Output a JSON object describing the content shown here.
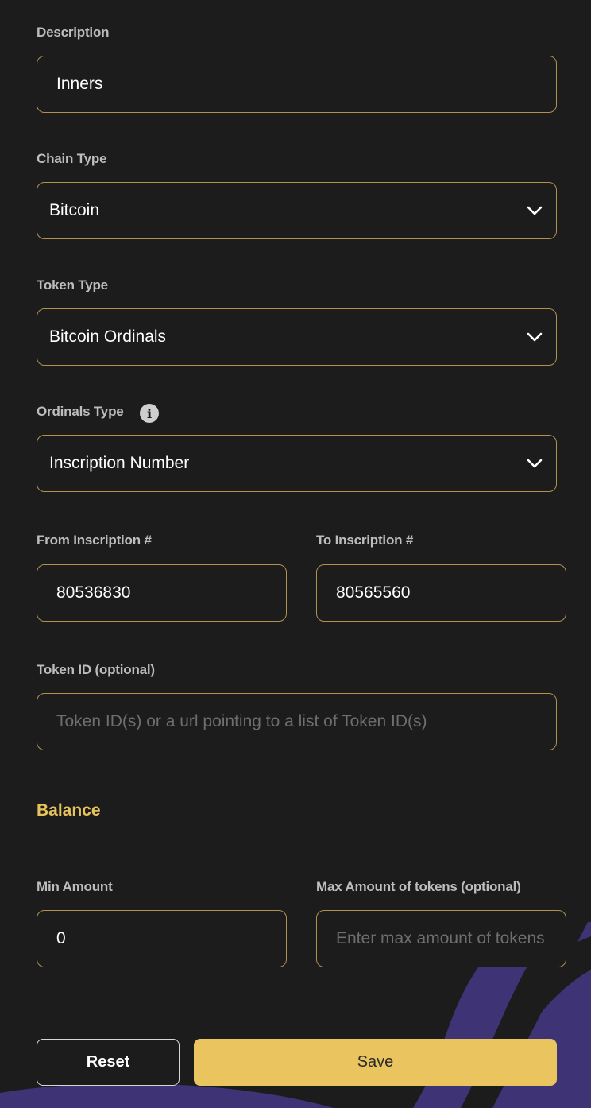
{
  "description": {
    "label": "Description",
    "value": "Inners"
  },
  "chain_type": {
    "label": "Chain Type",
    "value": "Bitcoin"
  },
  "token_type": {
    "label": "Token Type",
    "value": "Bitcoin Ordinals"
  },
  "ordinals_type": {
    "label": "Ordinals Type",
    "value": "Inscription Number",
    "info_icon": "info-icon"
  },
  "from_inscription": {
    "label": "From Inscription #",
    "value": "80536830"
  },
  "to_inscription": {
    "label": "To Inscription #",
    "value": "80565560"
  },
  "token_id": {
    "label": "Token ID (optional)",
    "placeholder": "Token ID(s) or a url pointing to a list of Token ID(s)"
  },
  "balance": {
    "title": "Balance",
    "min_amount": {
      "label": "Min Amount",
      "value": "0"
    },
    "max_amount": {
      "label": "Max Amount of tokens (optional)",
      "placeholder": "Enter max amount of tokens"
    }
  },
  "actions": {
    "reset_label": "Reset",
    "save_label": "Save"
  },
  "colors": {
    "accent": "#e9c45f",
    "border": "#b0924d",
    "background": "#1c1c1c",
    "decor": "#3d3375"
  }
}
